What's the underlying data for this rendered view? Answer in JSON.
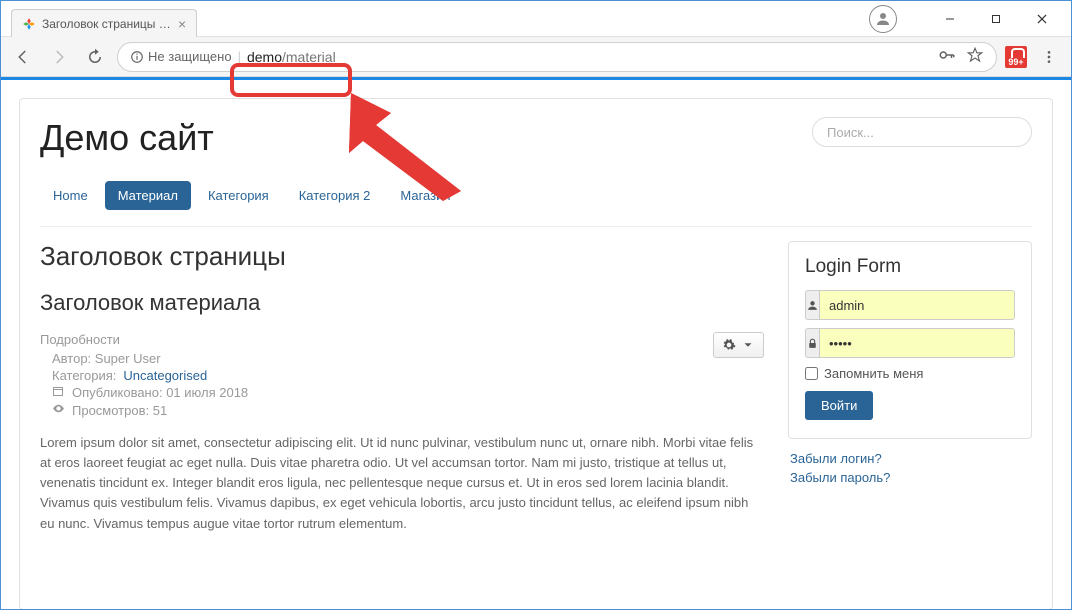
{
  "browser": {
    "tab_label": "Заголовок страницы в б",
    "security_label": "Не защищено",
    "url_host": "demo",
    "url_path": "/material",
    "ext_badge": "99+"
  },
  "site": {
    "title": "Демо сайт",
    "search_placeholder": "Поиск..."
  },
  "nav": {
    "items": [
      {
        "label": "Home",
        "active": false
      },
      {
        "label": "Материал",
        "active": true
      },
      {
        "label": "Категория",
        "active": false
      },
      {
        "label": "Категория 2",
        "active": false
      },
      {
        "label": "Магазин",
        "active": false
      }
    ]
  },
  "article": {
    "page_title": "Заголовок страницы",
    "article_title": "Заголовок материала",
    "details_label": "Подробности",
    "author_label": "Автор: Super User",
    "category_label": "Категория:",
    "category_link": "Uncategorised",
    "published_label": "Опубликовано: 01 июля 2018",
    "hits_label": "Просмотров: 51",
    "body": "Lorem ipsum dolor sit amet, consectetur adipiscing elit. Ut id nunc pulvinar, vestibulum nunc ut, ornare nibh. Morbi vitae felis at eros laoreet feugiat ac eget nulla. Duis vitae pharetra odio. Ut vel accumsan tortor. Nam mi justo, tristique at tellus ut, venenatis tincidunt ex. Integer blandit eros ligula, nec pellentesque neque cursus et. Ut in eros sed lorem lacinia blandit. Vivamus quis vestibulum felis. Vivamus dapibus, ex eget vehicula lobortis, arcu justo tincidunt tellus, ac eleifend ipsum nibh eu nunc. Vivamus tempus augue vitae tortor rutrum elementum."
  },
  "login": {
    "title": "Login Form",
    "username": "admin",
    "password": "•••••",
    "remember_label": "Запомнить меня",
    "submit_label": "Войти",
    "forgot_login": "Забыли логин?",
    "forgot_password": "Забыли пароль?"
  }
}
